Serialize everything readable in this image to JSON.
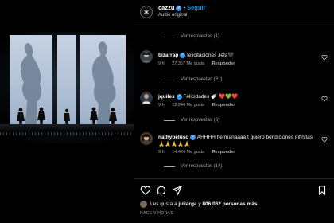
{
  "header": {
    "username": "cazzu",
    "separator": "•",
    "follow_label": "Seguir",
    "subtitle": "Audio original"
  },
  "thread": {
    "top_view_replies": "Ver respuestas (1)",
    "comments": [
      {
        "user": "bizarrap",
        "text": "felicitaciones Jefa🖤",
        "time": "9 h",
        "likes": "27.357 Me gusta",
        "reply": "Responder",
        "view_replies": "Ver respuestas (31)"
      },
      {
        "user": "jquiles",
        "text": "Felicidades 🍼 ❤️💚❤️",
        "time": "9 h",
        "likes": "12.244 Me gusta",
        "reply": "Responder",
        "view_replies": "Ver respuestas (6)"
      },
      {
        "user": "nathypeluso",
        "text": "AHHHH hermanaaaa t quiero bendiciones infinitas🙏🙏🙏🙏🙏",
        "time": "9 h",
        "likes": "14.424 Me gusta",
        "reply": "Responder",
        "view_replies": "Ver respuestas (14)"
      }
    ]
  },
  "footer": {
    "likes_prefix": "Les gusta a",
    "liker": "juliarga",
    "likes_joiner": "y",
    "likes_count": "806.062 personas más",
    "time_ago": "HACE 9 HORAS"
  },
  "colors": {
    "accent": "#0095f6",
    "verified": "#3897f0",
    "muted": "#a8a8a8"
  }
}
